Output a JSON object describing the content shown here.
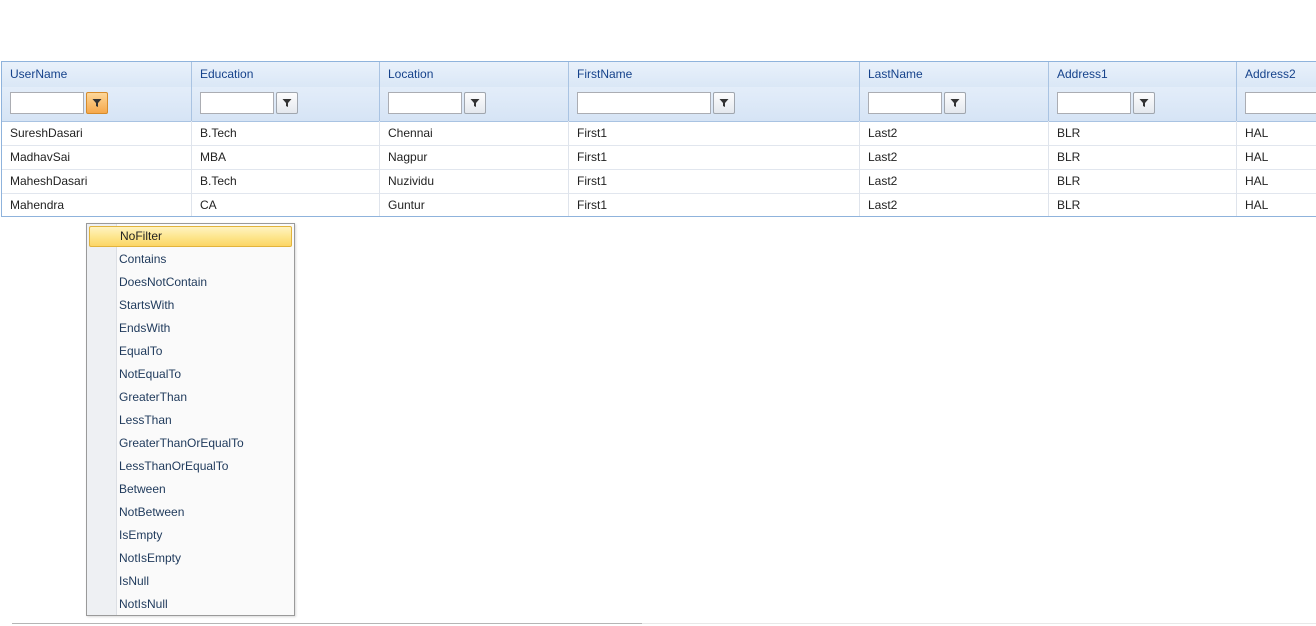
{
  "columns": [
    "UserName",
    "Education",
    "Location",
    "FirstName",
    "LastName",
    "Address1",
    "Address2"
  ],
  "rows": [
    [
      "SureshDasari",
      "B.Tech",
      "Chennai",
      "First1",
      "Last2",
      "BLR",
      "HAL"
    ],
    [
      "MadhavSai",
      "MBA",
      "Nagpur",
      "First1",
      "Last2",
      "BLR",
      "HAL"
    ],
    [
      "MaheshDasari",
      "B.Tech",
      "Nuzividu",
      "First1",
      "Last2",
      "BLR",
      "HAL"
    ],
    [
      "Mahendra",
      "CA",
      "Guntur",
      "First1",
      "Last2",
      "BLR",
      "HAL"
    ]
  ],
  "filter_values": [
    "",
    "",
    "",
    "",
    "",
    "",
    ""
  ],
  "active_filter_column": "UserName",
  "filter_menu": {
    "selected": "NoFilter",
    "items": [
      "NoFilter",
      "Contains",
      "DoesNotContain",
      "StartsWith",
      "EndsWith",
      "EqualTo",
      "NotEqualTo",
      "GreaterThan",
      "LessThan",
      "GreaterThanOrEqualTo",
      "LessThanOrEqualTo",
      "Between",
      "NotBetween",
      "IsEmpty",
      "NotIsEmpty",
      "IsNull",
      "NotIsNull"
    ]
  },
  "icons": {
    "filter": "funnel-icon"
  },
  "colors": {
    "header_text": "#15428b",
    "menu_text": "#1e395b",
    "active_filter": "#f6a84b",
    "selection": "#fde58b"
  }
}
